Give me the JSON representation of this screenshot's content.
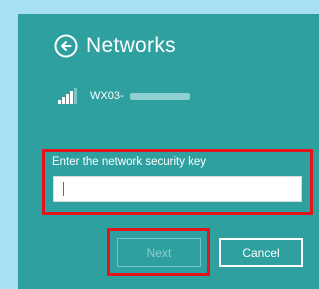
{
  "panel": {
    "title": "Networks",
    "back_icon": "back-arrow-circle-icon"
  },
  "network": {
    "ssid_prefix": "WX03-",
    "signal_icon": "wifi-signal-bars-icon"
  },
  "security_key": {
    "label": "Enter the network security key",
    "value": ""
  },
  "buttons": {
    "next_label": "Next",
    "cancel_label": "Cancel"
  },
  "colors": {
    "flyout_background": "#2fa0a0",
    "desktop_background": "#a8dff3",
    "highlight_border": "#e3141b",
    "text": "#ffffff"
  }
}
